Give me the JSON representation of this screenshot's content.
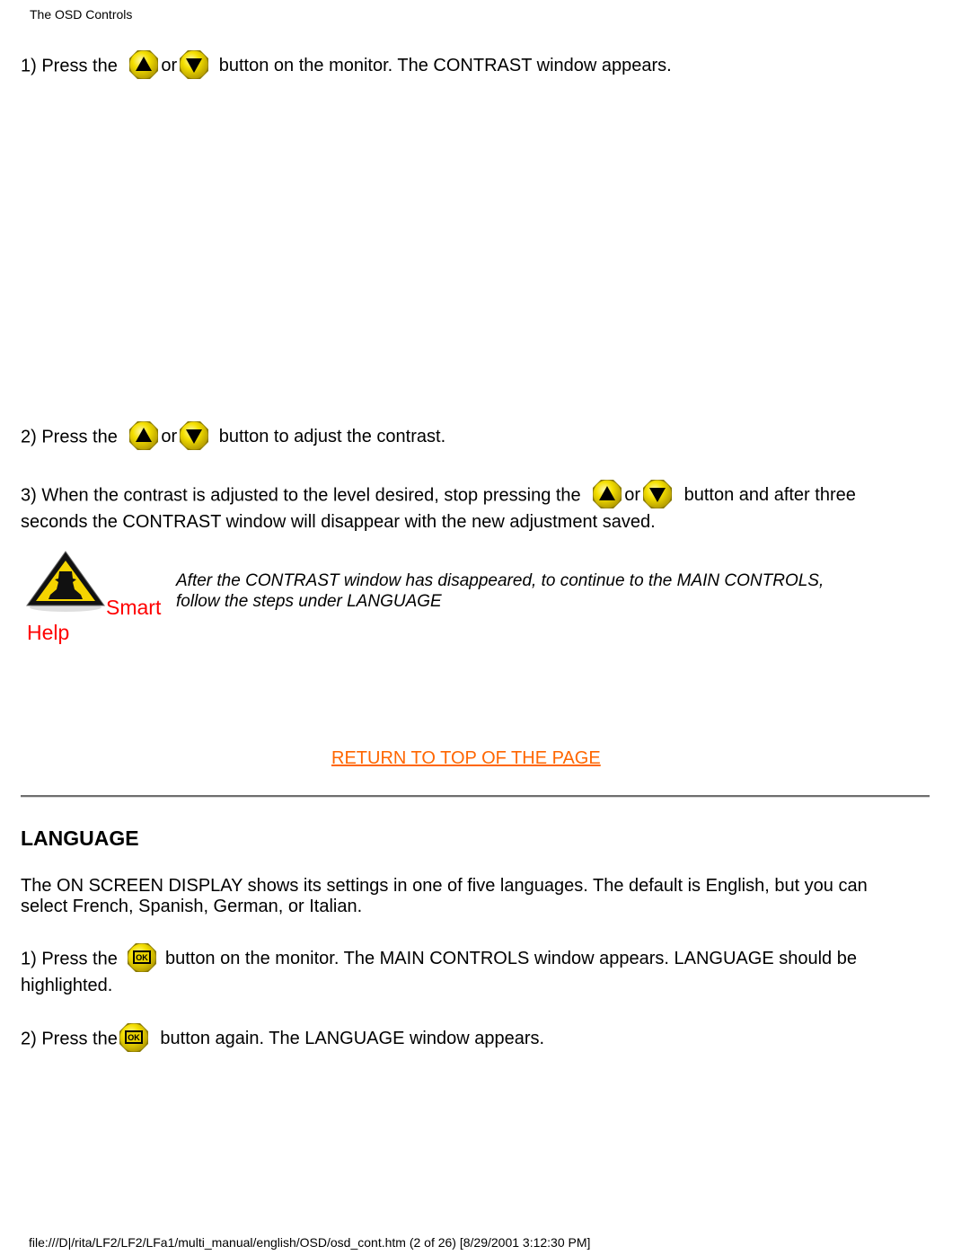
{
  "header": {
    "title": "The OSD Controls"
  },
  "contrast": {
    "step1": {
      "prefix": "1) Press the",
      "or": "or",
      "suffix": "button on the monitor. The CONTRAST window appears."
    },
    "step2": {
      "prefix": "2) Press the",
      "or": "or",
      "suffix": "button to adjust the contrast."
    },
    "step3": {
      "prefix": "3) When the contrast is adjusted to the level desired, stop pressing the",
      "or": "or",
      "suffix": "button and after three",
      "line2": "seconds the CONTRAST window will disappear with the new adjustment saved."
    },
    "smart_help": {
      "label_smart": "Smart",
      "label_help": "Help",
      "note_line1": "After the CONTRAST window has disappeared, to continue to the MAIN CONTROLS,",
      "note_line2": "follow the steps under LANGUAGE"
    },
    "return_link": "RETURN TO TOP OF THE PAGE"
  },
  "language": {
    "title": "LANGUAGE",
    "intro_line1": "The ON SCREEN DISPLAY shows its settings in one of five languages. The default is English, but you can",
    "intro_line2": "select French, Spanish, German, or Italian.",
    "step1": {
      "prefix": "1) Press the",
      "suffix": "button on the monitor. The MAIN CONTROLS window appears. LANGUAGE should be",
      "line2": "highlighted."
    },
    "step2": {
      "prefix": "2) Press the",
      "suffix": "button again. The LANGUAGE window appears."
    }
  },
  "icons": {
    "up": "up-arrow-button-icon",
    "down": "down-arrow-button-icon",
    "ok": "ok-button-icon",
    "smart_help": "smart-help-warning-icon"
  },
  "colors": {
    "button_yellow": "#f5e000",
    "smart_help_red": "#ff0000",
    "link_orange": "#ff6600"
  },
  "footer": {
    "path_text": "file:///D|/rita/LF2/LF2/LFa1/multi_manual/english/OSD/osd_cont.htm (2 of 26) [8/29/2001 3:12:30 PM]"
  }
}
